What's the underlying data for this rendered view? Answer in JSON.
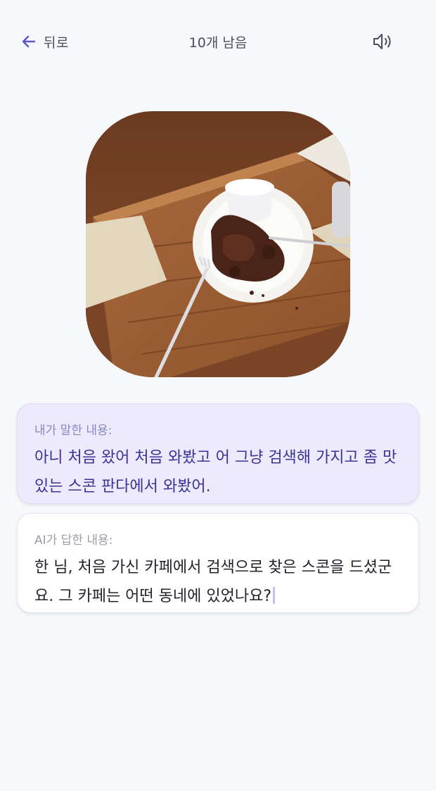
{
  "header": {
    "back_label": "뒤로",
    "title": "10개 남음",
    "back_icon": "arrow-left-icon",
    "sound_icon": "speaker-icon"
  },
  "photo": {
    "subject": "chocolate scone on a plate with forks on a wooden tray"
  },
  "user_card": {
    "label": "내가 말한 내용:",
    "text": "아니 처음 왔어 처음 와봤고 어 그냥 검색해 가지고 좀 맛있는 스콘 판다에서 와봤어."
  },
  "ai_card": {
    "label": "AI가 답한 내용:",
    "text": "한 님, 처음 가신 카페에서 검색으로 찾은 스콘을 드셨군요. 그 카페는 어떤 동네에 있었나요?"
  },
  "colors": {
    "accent": "#5b55c9",
    "user_card_bg": "#eceafc",
    "user_text": "#3b3398",
    "background": "#f7f8fb"
  }
}
